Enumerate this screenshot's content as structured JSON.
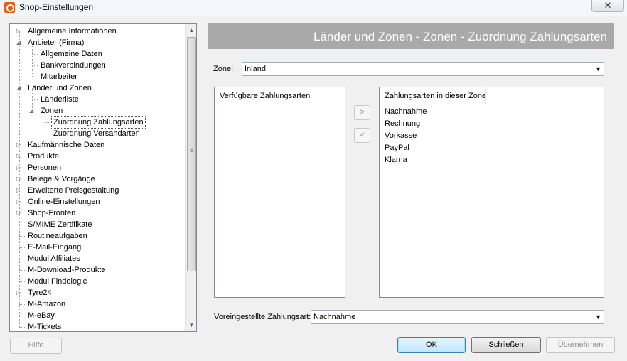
{
  "window": {
    "title": "Shop-Einstellungen",
    "close_label": "✕"
  },
  "tree": {
    "items": [
      {
        "label": "Allgemeine Informationen",
        "level": 1,
        "expander": "collapsed"
      },
      {
        "label": "Anbieter (Firma)",
        "level": 1,
        "expander": "expanded"
      },
      {
        "label": "Allgemeine Daten",
        "level": 2,
        "expander": "none"
      },
      {
        "label": "Bankverbindungen",
        "level": 2,
        "expander": "none"
      },
      {
        "label": "Mitarbeiter",
        "level": 2,
        "expander": "none"
      },
      {
        "label": "Länder und Zonen",
        "level": 1,
        "expander": "expanded"
      },
      {
        "label": "Länderliste",
        "level": 2,
        "expander": "none"
      },
      {
        "label": "Zonen",
        "level": 2,
        "expander": "expanded"
      },
      {
        "label": "Zuordnung Zahlungsarten",
        "level": 3,
        "expander": "none",
        "selected": true
      },
      {
        "label": "Zuordnung Versandarten",
        "level": 3,
        "expander": "none"
      },
      {
        "label": "Kaufmännische Daten",
        "level": 1,
        "expander": "collapsed"
      },
      {
        "label": "Produkte",
        "level": 1,
        "expander": "collapsed"
      },
      {
        "label": "Personen",
        "level": 1,
        "expander": "collapsed"
      },
      {
        "label": "Belege & Vorgänge",
        "level": 1,
        "expander": "collapsed"
      },
      {
        "label": "Erweiterte Preisgestaltung",
        "level": 1,
        "expander": "collapsed"
      },
      {
        "label": "Online-Einstellungen",
        "level": 1,
        "expander": "collapsed"
      },
      {
        "label": "Shop-Fronten",
        "level": 1,
        "expander": "collapsed"
      },
      {
        "label": "S/MIME Zertifikate",
        "level": 1,
        "expander": "none"
      },
      {
        "label": "Routineaufgaben",
        "level": 1,
        "expander": "none"
      },
      {
        "label": "E-Mail-Eingang",
        "level": 1,
        "expander": "none"
      },
      {
        "label": "Modul Affiliates",
        "level": 1,
        "expander": "none"
      },
      {
        "label": "M-Download-Produkte",
        "level": 1,
        "expander": "none"
      },
      {
        "label": "Modul Findologic",
        "level": 1,
        "expander": "none"
      },
      {
        "label": "Tyre24",
        "level": 1,
        "expander": "collapsed"
      },
      {
        "label": "M-Amazon",
        "level": 1,
        "expander": "none"
      },
      {
        "label": "M-eBay",
        "level": 1,
        "expander": "none"
      },
      {
        "label": "M-Tickets",
        "level": 1,
        "expander": "none"
      }
    ]
  },
  "header": {
    "title": "Länder und Zonen - Zonen - Zuordnung Zahlungsarten"
  },
  "zone": {
    "label": "Zone:",
    "value": "Inland"
  },
  "available_list": {
    "header": "Verfügbare Zahlungsarten",
    "items": []
  },
  "zone_list": {
    "header": "Zahlungsarten in dieser Zone",
    "items": [
      "Nachnahme",
      "Rechnung",
      "Vorkasse",
      "PayPal",
      " Klarna"
    ]
  },
  "move_buttons": {
    "add_label": ">",
    "remove_label": "<"
  },
  "default_payment": {
    "label": "Voreingestellte Zahlungsart:",
    "value": "Nachnahme"
  },
  "buttons": {
    "help": "Hilfe",
    "ok": "OK",
    "close": "Schließen",
    "apply": "Übernehmen"
  },
  "icons": {
    "expander_collapsed": "triangle-right-icon",
    "expander_expanded": "triangle-down-icon",
    "dropdown": "chevron-down-icon"
  },
  "colors": {
    "header_background": "#a9a9a9",
    "app_icon": "#e85d12"
  }
}
